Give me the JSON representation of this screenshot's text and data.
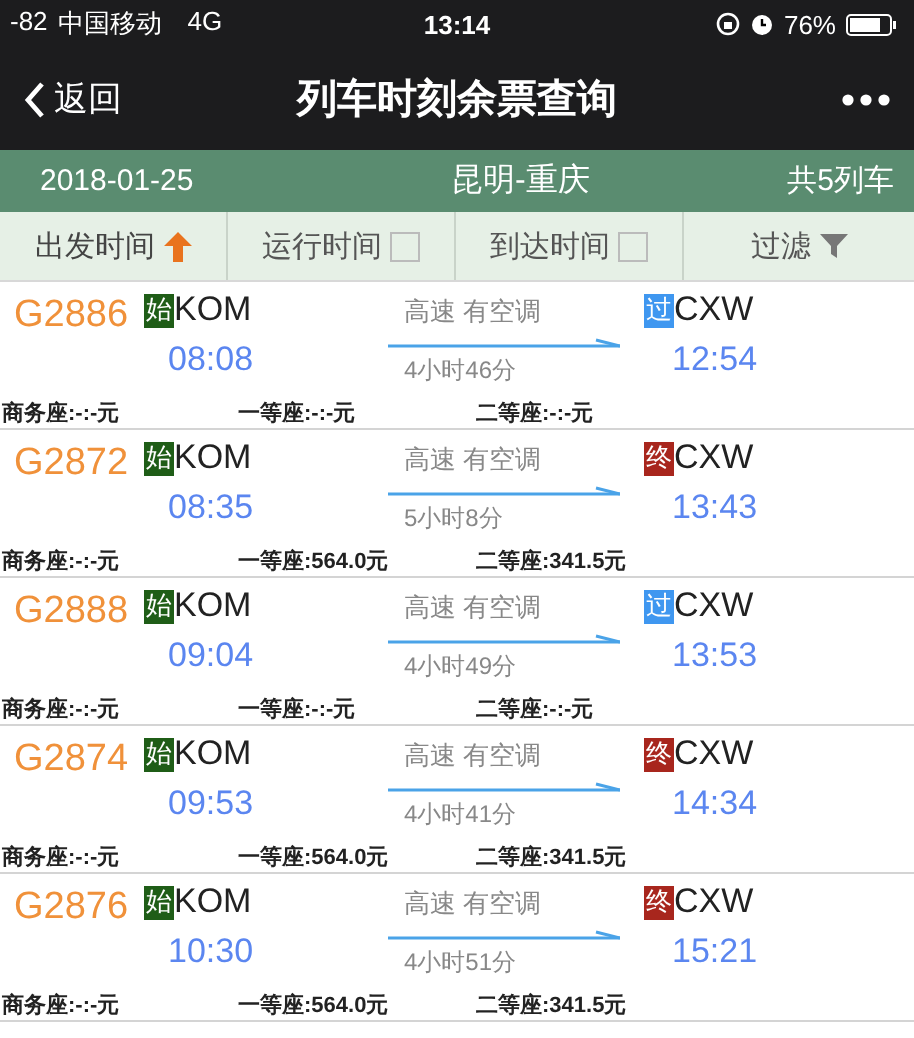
{
  "status_bar": {
    "signal": "-82",
    "carrier": "中国移动",
    "network": "4G",
    "time": "13:14",
    "battery": "76%"
  },
  "nav": {
    "back": "返回",
    "title": "列车时刻余票查询"
  },
  "summary": {
    "date": "2018-01-25",
    "route": "昆明-重庆",
    "count": "共5列车"
  },
  "sort_options": [
    {
      "label": "出发时间",
      "kind": "sort",
      "selected": true
    },
    {
      "label": "运行时间",
      "kind": "sort",
      "selected": false
    },
    {
      "label": "到达时间",
      "kind": "sort",
      "selected": false
    },
    {
      "label": "过滤",
      "kind": "filter",
      "selected": false
    }
  ],
  "trains": [
    {
      "number": "G2886",
      "from_badge": {
        "kind": "start",
        "text": "始"
      },
      "from": "KOM",
      "depart": "08:08",
      "type": "高速 有空调",
      "duration": "4小时46分",
      "to_badge": {
        "kind": "pass",
        "text": "过"
      },
      "to": "CXW",
      "arrive": "12:54",
      "seats": [
        "商务座:-:-元",
        "一等座:-:-元",
        "二等座:-:-元"
      ]
    },
    {
      "number": "G2872",
      "from_badge": {
        "kind": "start",
        "text": "始"
      },
      "from": "KOM",
      "depart": "08:35",
      "type": "高速 有空调",
      "duration": "5小时8分",
      "to_badge": {
        "kind": "end",
        "text": "终"
      },
      "to": "CXW",
      "arrive": "13:43",
      "seats": [
        "商务座:-:-元",
        "一等座:564.0元",
        "二等座:341.5元"
      ]
    },
    {
      "number": "G2888",
      "from_badge": {
        "kind": "start",
        "text": "始"
      },
      "from": "KOM",
      "depart": "09:04",
      "type": "高速 有空调",
      "duration": "4小时49分",
      "to_badge": {
        "kind": "pass",
        "text": "过"
      },
      "to": "CXW",
      "arrive": "13:53",
      "seats": [
        "商务座:-:-元",
        "一等座:-:-元",
        "二等座:-:-元"
      ]
    },
    {
      "number": "G2874",
      "from_badge": {
        "kind": "start",
        "text": "始"
      },
      "from": "KOM",
      "depart": "09:53",
      "type": "高速 有空调",
      "duration": "4小时41分",
      "to_badge": {
        "kind": "end",
        "text": "终"
      },
      "to": "CXW",
      "arrive": "14:34",
      "seats": [
        "商务座:-:-元",
        "一等座:564.0元",
        "二等座:341.5元"
      ]
    },
    {
      "number": "G2876",
      "from_badge": {
        "kind": "start",
        "text": "始"
      },
      "from": "KOM",
      "depart": "10:30",
      "type": "高速 有空调",
      "duration": "4小时51分",
      "to_badge": {
        "kind": "end",
        "text": "终"
      },
      "to": "CXW",
      "arrive": "15:21",
      "seats": [
        "商务座:-:-元",
        "一等座:564.0元",
        "二等座:341.5元"
      ]
    }
  ]
}
